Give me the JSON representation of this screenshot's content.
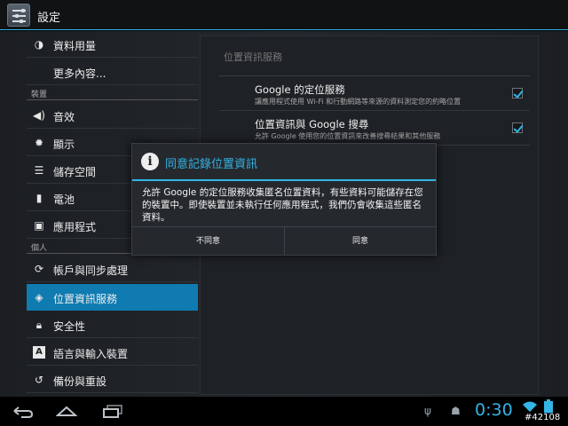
{
  "app": {
    "title": "設定",
    "icon": "settings-app-icon"
  },
  "sidebar": {
    "items": [
      {
        "label": "資料用量",
        "icon": "data-usage-icon"
      },
      {
        "label": "更多內容...",
        "icon": ""
      },
      {
        "header": "裝置"
      },
      {
        "label": "音效",
        "icon": "volume-icon"
      },
      {
        "label": "顯示",
        "icon": "brightness-icon"
      },
      {
        "label": "儲存空間",
        "icon": "storage-icon"
      },
      {
        "label": "電池",
        "icon": "battery-icon"
      },
      {
        "label": "應用程式",
        "icon": "apps-icon"
      },
      {
        "header": "個人"
      },
      {
        "label": "帳戶與同步處理",
        "icon": "sync-icon"
      },
      {
        "label": "位置資訊服務",
        "icon": "location-icon",
        "selected": true
      },
      {
        "label": "安全性",
        "icon": "lock-icon"
      },
      {
        "label": "語言與輸入裝置",
        "icon": "language-icon"
      },
      {
        "label": "備份與重設",
        "icon": "backup-icon"
      }
    ]
  },
  "location": {
    "section_title": "位置資訊服務",
    "options": [
      {
        "title": "Google 的定位服務",
        "summary": "讓應用程式使用 Wi-Fi 和行動網路等來源的資料測定您的約略位置",
        "checked": true
      },
      {
        "title": "位置資訊與 Google 搜尋",
        "summary": "允許 Google 使用您的位置資訊來改善搜尋結果和其他服務",
        "checked": true
      }
    ]
  },
  "dialog": {
    "icon": "info-icon",
    "title": "同意記錄位置資訊",
    "message": "允許 Google 的定位服務收集匿名位置資料，有些資料可能儲存在您的裝置中。即使裝置並未執行任何應用程式，我們仍會收集這些匿名資料。",
    "decline_label": "不同意",
    "accept_label": "同意"
  },
  "navbar": {
    "clock": "0:30",
    "badge": "#42108",
    "back_icon": "back-icon",
    "home_icon": "home-icon",
    "recents_icon": "recents-icon"
  },
  "colors": {
    "accent": "#33b5e5",
    "selected": "#0f7bb0",
    "background": "#1e2125"
  }
}
